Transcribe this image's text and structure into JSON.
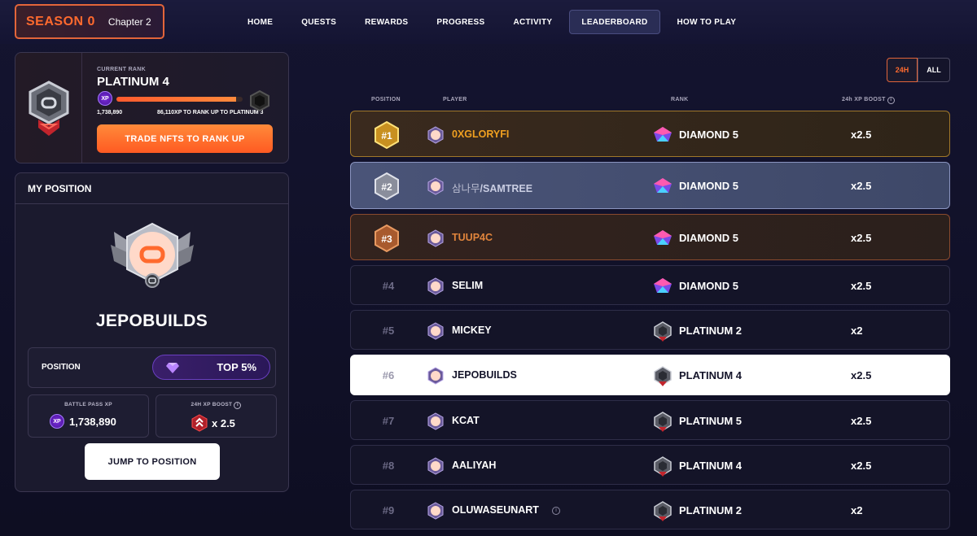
{
  "header": {
    "season_label": "SEASON 0",
    "chapter_label": "Chapter 2",
    "nav": [
      {
        "label": "HOME",
        "active": false
      },
      {
        "label": "QUESTS",
        "active": false
      },
      {
        "label": "REWARDS",
        "active": false
      },
      {
        "label": "PROGRESS",
        "active": false
      },
      {
        "label": "ACTIVITY",
        "active": false
      },
      {
        "label": "LEADERBOARD",
        "active": true
      },
      {
        "label": "HOW TO PLAY",
        "active": false
      }
    ]
  },
  "rank_card": {
    "current_rank_label": "CURRENT RANK",
    "rank_name": "PLATINUM 4",
    "xp_icon_text": "XP",
    "xp_value": "1,738,890",
    "xp_needed": "86,110XP TO RANK UP TO PLATINUM 3",
    "progress_fraction": 0.95,
    "trade_button": "TRADE NFTS TO RANK UP"
  },
  "my_position": {
    "title": "MY POSITION",
    "player_name": "JEPOBUILDS",
    "position_label": "POSITION",
    "top_pill": "TOP 5%",
    "battle_pass_label": "BATTLE PASS XP",
    "battle_pass_value": "1,738,890",
    "boost_label": "24H XP BOOST",
    "boost_value": "x 2.5",
    "jump_button": "JUMP TO POSITION"
  },
  "filters": {
    "opt_24h": "24H",
    "opt_all": "ALL",
    "selected": "24H"
  },
  "table": {
    "headers": {
      "position": "POSITION",
      "player": "PLAYER",
      "rank": "RANK",
      "boost": "24h XP BOOST"
    },
    "rows": [
      {
        "pos": "#1",
        "player": "0XGLORYFI",
        "rank": "DIAMOND 5",
        "boost": "x2.5",
        "style": "gold"
      },
      {
        "pos": "#2",
        "player_prefix": "삼나무",
        "player": "/SAMTREE",
        "rank": "DIAMOND 5",
        "boost": "x2.5",
        "style": "silver"
      },
      {
        "pos": "#3",
        "player": "TUUP4C",
        "rank": "DIAMOND 5",
        "boost": "x2.5",
        "style": "bronze"
      },
      {
        "pos": "#4",
        "player": "SELIM",
        "rank": "DIAMOND 5",
        "boost": "x2.5",
        "style": "normal"
      },
      {
        "pos": "#5",
        "player": "MICKEY",
        "rank": "PLATINUM 2",
        "boost": "x2",
        "style": "normal"
      },
      {
        "pos": "#6",
        "player": "JEPOBUILDS",
        "rank": "PLATINUM 4",
        "boost": "x2.5",
        "style": "me"
      },
      {
        "pos": "#7",
        "player": "KCAT",
        "rank": "PLATINUM 5",
        "boost": "x2.5",
        "style": "normal"
      },
      {
        "pos": "#8",
        "player": "AALIYAH",
        "rank": "PLATINUM 4",
        "boost": "x2.5",
        "style": "normal"
      },
      {
        "pos": "#9",
        "player": "OLUWASEUNART",
        "rank": "PLATINUM 2",
        "boost": "x2",
        "style": "normal"
      }
    ]
  },
  "colors": {
    "accent": "#ff6a2e",
    "gold": "#f0a020",
    "background": "#101026"
  }
}
